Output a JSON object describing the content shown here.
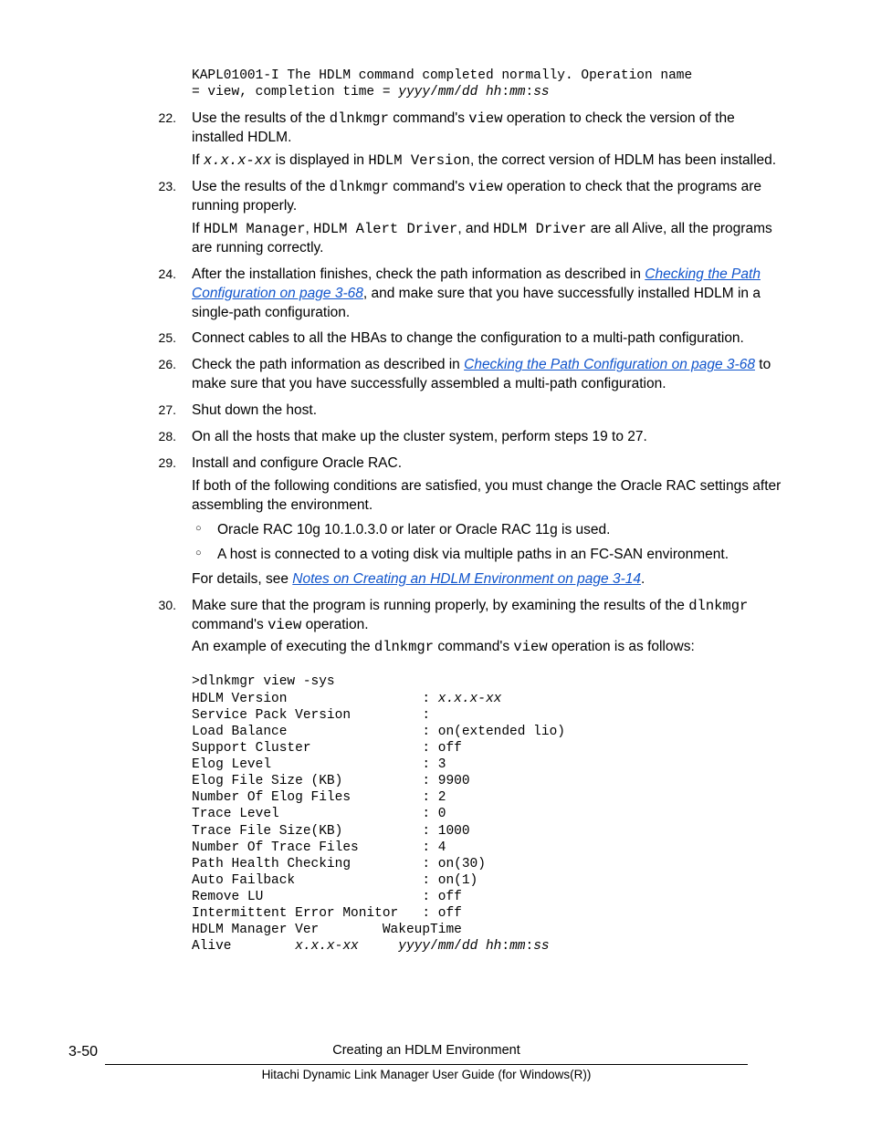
{
  "top_code": "KAPL01001-I The HDLM command completed normally. Operation name\n= view, completion time = ",
  "top_code_tail": "yyyy",
  "top_code_tail2": "/",
  "top_code_tail3": "mm",
  "top_code_tail4": "/",
  "top_code_tail5": "dd hh",
  "top_code_tail6": ":",
  "top_code_tail7": "mm",
  "top_code_tail8": ":",
  "top_code_tail9": "ss",
  "items": {
    "22": {
      "num": "22.",
      "a1": "Use the results of the ",
      "a2": "dlnkmgr",
      "a3": " command's ",
      "a4": "view",
      "a5": " operation to check the version of the installed HDLM.",
      "b1": "If ",
      "b2": "x.x.x-xx",
      "b3": " is displayed in ",
      "b4": "HDLM Version",
      "b5": ", the correct version of HDLM has been installed."
    },
    "23": {
      "num": "23.",
      "a1": "Use the results of the ",
      "a2": "dlnkmgr",
      "a3": " command's ",
      "a4": "view",
      "a5": " operation to check that the programs are running properly.",
      "b1": "If ",
      "b2": "HDLM Manager",
      "b3": ", ",
      "b4": "HDLM Alert Driver",
      "b5": ", and ",
      "b6": "HDLM Driver",
      "b7": " are all Alive, all the programs are running correctly."
    },
    "24": {
      "num": "24.",
      "a1": "After the installation finishes, check the path information as described in ",
      "link": "Checking the Path Configuration on page 3-68",
      "a2": ", and make sure that you have successfully installed HDLM in a single-path configuration."
    },
    "25": {
      "num": "25.",
      "a": "Connect cables to all the HBAs to change the configuration to a multi-path configuration."
    },
    "26": {
      "num": "26.",
      "a1": "Check the path information as described in ",
      "link": "Checking the Path Configuration on page 3-68",
      "a2": " to make sure that you have successfully assembled a multi-path configuration."
    },
    "27": {
      "num": "27.",
      "a": "Shut down the host."
    },
    "28": {
      "num": "28.",
      "a": "On all the hosts that make up the cluster system, perform steps 19 to 27."
    },
    "29": {
      "num": "29.",
      "a": "Install and configure Oracle RAC.",
      "b": "If both of the following conditions are satisfied, you must change the Oracle RAC settings after assembling the environment.",
      "bullet1": "Oracle RAC 10g 10.1.0.3.0 or later or Oracle RAC 11g is used.",
      "bullet2": "A host is connected to a voting disk via multiple paths in an FC-SAN environment.",
      "c1": "For details, see ",
      "link": "Notes on Creating an HDLM Environment on page 3-14",
      "c2": "."
    },
    "30": {
      "num": "30.",
      "a1": "Make sure that the program is running properly, by examining the results of the ",
      "a2": "dlnkmgr",
      "a3": " command's ",
      "a4": "view",
      "a5": " operation.",
      "b1": "An example of executing the ",
      "b2": "dlnkmgr",
      "b3": " command's ",
      "b4": "view",
      "b5": " operation is as follows:"
    }
  },
  "output": {
    "l0": ">dlnkmgr view -sys",
    "l1a": "HDLM Version                 : ",
    "l1b": "x.x.x-xx",
    "l2": "Service Pack Version         :",
    "l3": "Load Balance                 : on(extended lio)",
    "l4": "Support Cluster              : off",
    "l5": "Elog Level                   : 3",
    "l6": "Elog File Size (KB)          : 9900",
    "l7": "Number Of Elog Files         : 2",
    "l8": "Trace Level                  : 0",
    "l9": "Trace File Size(KB)          : 1000",
    "l10": "Number Of Trace Files        : 4",
    "l11": "Path Health Checking         : on(30)",
    "l12": "Auto Failback                : on(1)",
    "l13": "Remove LU                    : off",
    "l14": "Intermittent Error Monitor   : off",
    "l15": "HDLM Manager Ver        WakeupTime",
    "l16a": "Alive        ",
    "l16b": "x.x.x-xx     yyyy",
    "l16c": "/",
    "l16d": "mm",
    "l16e": "/",
    "l16f": "dd hh",
    "l16g": ":",
    "l16h": "mm",
    "l16i": ":",
    "l16j": "ss"
  },
  "footer": {
    "page": "3-50",
    "title": "Creating an HDLM Environment",
    "sub": "Hitachi Dynamic Link Manager User Guide (for Windows(R))"
  }
}
